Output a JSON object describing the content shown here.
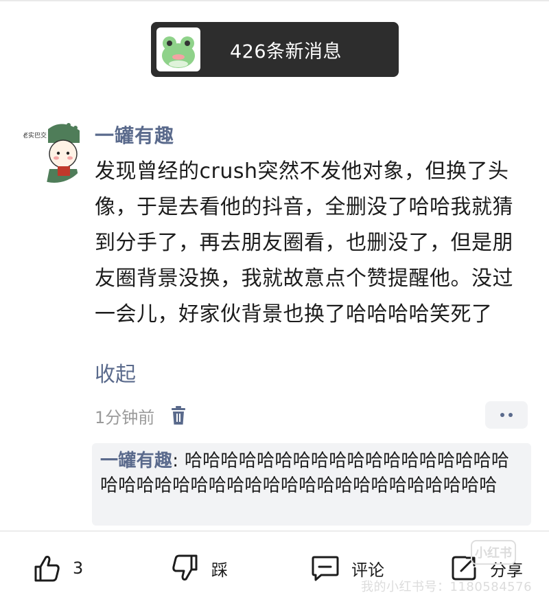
{
  "banner": {
    "text": "426条新消息"
  },
  "comment": {
    "username": "一罐有趣",
    "avatar_caption": "老实巴交",
    "text": "发现曾经的crush突然不发他对象，但换了头像，于是去看他的抖音，全删没了哈哈我就猜到分手了，再去朋友圈看，也删没了，但是朋友圈背景没换，我就故意点个赞提醒他。没过一会儿，好家伙背景也换了哈哈哈哈笑死了",
    "collapse_label": "收起",
    "time": "1分钟前"
  },
  "reply": {
    "author": "一罐有趣",
    "separator": ":",
    "text": " 哈哈哈哈哈哈哈哈哈哈哈哈哈哈哈哈哈哈哈哈哈哈哈哈哈哈哈哈哈哈哈哈哈哈哈哈哈哈哈哈"
  },
  "actions": {
    "like_count": "3",
    "dislike_label": "踩",
    "comment_label": "评论",
    "share_label": "分享"
  },
  "watermark": {
    "logo": "小红书",
    "text": "我的小红书号：1180584576"
  },
  "colors": {
    "accent": "#5a6a8c",
    "banner_bg": "#2d2d2d",
    "reply_bg": "#f2f3f5"
  }
}
